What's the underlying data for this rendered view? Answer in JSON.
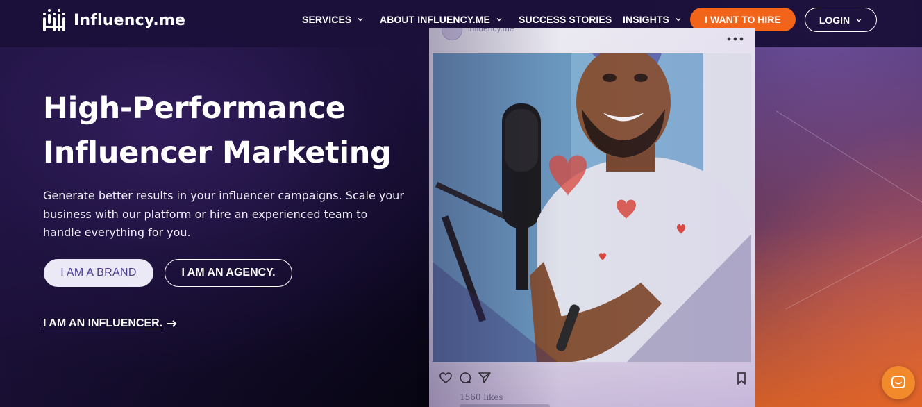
{
  "brand": {
    "name": "Influency.me"
  },
  "nav": {
    "items": [
      {
        "label": "SERVICES",
        "has_dropdown": true
      },
      {
        "label": "ABOUT INFLUENCY.ME",
        "has_dropdown": true
      },
      {
        "label": "SUCCESS STORIES",
        "has_dropdown": false
      },
      {
        "label": "INSIGHTS",
        "has_dropdown": true
      }
    ],
    "hire_label": "I WANT TO HIRE",
    "login_label": "LOGIN"
  },
  "hero": {
    "title_line1": "High-Performance",
    "title_line2": "Influencer Marketing",
    "subtitle": "Generate better results in your influencer campaigns. Scale your business with our platform or hire an experienced team to handle everything for you.",
    "brand_button": "I AM A BRAND",
    "agency_button": "I AM AN AGENCY.",
    "influencer_link": "I AM AN INFLUENCER."
  },
  "post": {
    "handle": "influency.me",
    "likes": "1560 likes"
  },
  "colors": {
    "accent": "#f26419",
    "nav_bg": "#1a103a",
    "brand_button_text": "#4c3c8c",
    "chat_button": "#f28a2c"
  },
  "icons": [
    "logo-icon",
    "chevron-down-icon",
    "arrow-right-icon",
    "heart-icon",
    "comment-icon",
    "send-icon",
    "bookmark-icon",
    "more-icon",
    "chat-icon"
  ]
}
